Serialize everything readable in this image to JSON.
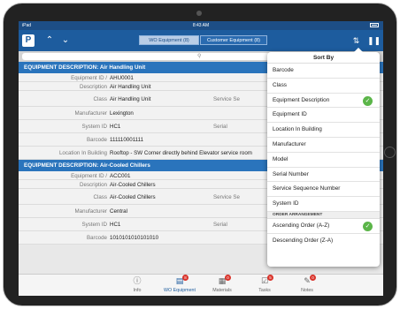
{
  "status_bar": {
    "carrier": "iPad",
    "time": "8:43 AM"
  },
  "navbar": {
    "logo_text": "P",
    "back_icon": "chevron-up-icon",
    "forward_icon": "chevron-down-icon",
    "segments": [
      {
        "label": "WO Equipment (8)",
        "active": true
      },
      {
        "label": "Customer Equipment (8)",
        "active": false
      }
    ],
    "sort_icon": "sort-icon",
    "barcode_icon": "barcode-icon"
  },
  "search": {
    "icon": "search-icon",
    "placeholder": ""
  },
  "sections": [
    {
      "header": "EQUIPMENT DESCRIPTION: Air Handling Unit",
      "rows": [
        {
          "label": "Equipment ID /",
          "value": "AHU0001",
          "extra": ""
        },
        {
          "label": "Description",
          "value": "Air Handling Unit",
          "extra": ""
        },
        {
          "label": "Class",
          "value": "Air Handling Unit",
          "extra": "Service Se"
        },
        {
          "label": "Manufacturer",
          "value": "Lexington",
          "extra": ""
        },
        {
          "label": "System ID",
          "value": "HC1",
          "extra": "Serial"
        },
        {
          "label": "Barcode",
          "value": "111110001111",
          "extra": ""
        },
        {
          "label": "Location In Building",
          "value": "Rooftop - SW Corner directly behind Elevator service room",
          "extra": ""
        }
      ]
    },
    {
      "header": "EQUIPMENT DESCRIPTION: Air-Cooled Chillers",
      "rows": [
        {
          "label": "Equipment ID /",
          "value": "ACC001",
          "extra": ""
        },
        {
          "label": "Description",
          "value": "Air-Cooled Chillers",
          "extra": ""
        },
        {
          "label": "Class",
          "value": "Air-Cooled Chillers",
          "extra": "Service Se"
        },
        {
          "label": "Manufacturer",
          "value": "Central",
          "extra": ""
        },
        {
          "label": "System ID",
          "value": "HC1",
          "extra": "Serial"
        },
        {
          "label": "Barcode",
          "value": "1010101010101010",
          "extra": ""
        }
      ]
    }
  ],
  "sort_popover": {
    "title": "Sort By",
    "options": [
      {
        "label": "Barcode",
        "selected": false
      },
      {
        "label": "Class",
        "selected": false
      },
      {
        "label": "Equipment Description",
        "selected": true
      },
      {
        "label": "Equipment ID",
        "selected": false
      },
      {
        "label": "Location In Building",
        "selected": false
      },
      {
        "label": "Manufacturer",
        "selected": false
      },
      {
        "label": "Model",
        "selected": false
      },
      {
        "label": "Serial Number",
        "selected": false
      },
      {
        "label": "Service Sequence Number",
        "selected": false
      },
      {
        "label": "System ID",
        "selected": false
      }
    ],
    "order_section_title": "ORDER ARRANGEMENT",
    "order_options": [
      {
        "label": "Ascending Order (A-Z)",
        "selected": true
      },
      {
        "label": "Descending Order (Z-A)",
        "selected": false
      }
    ]
  },
  "tabbar": {
    "tabs": [
      {
        "label": "Info",
        "icon": "info-icon",
        "badge": "",
        "active": false
      },
      {
        "label": "WO Equipment",
        "icon": "equipment-icon",
        "badge": "8",
        "active": true
      },
      {
        "label": "Materials",
        "icon": "materials-icon",
        "badge": "0",
        "active": false
      },
      {
        "label": "Tasks",
        "icon": "tasks-icon",
        "badge": "5",
        "active": false
      },
      {
        "label": "Notes",
        "icon": "notes-icon",
        "badge": "0",
        "active": false
      }
    ]
  },
  "colors": {
    "navbar": "#1d5c9e",
    "section_header": "#2a74bc",
    "check": "#5bb549",
    "badge": "#d9342b"
  }
}
